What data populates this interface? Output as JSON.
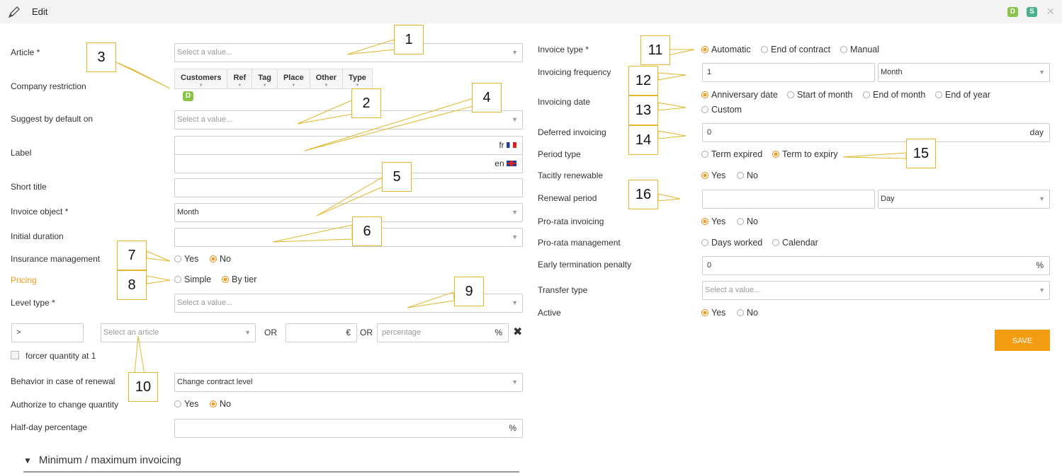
{
  "header": {
    "title": "Edit",
    "badge_d": "D",
    "badge_s": "S",
    "close": "✕",
    "icon": "pencil-icon"
  },
  "colors": {
    "accent": "#f39c12",
    "badge_d": "#8bc34a",
    "badge_s": "#4caf8f",
    "callout_border": "#e3b72c"
  },
  "left": {
    "article_label": "Article *",
    "article_placeholder": "Select a value...",
    "company_restriction_label": "Company restriction",
    "company_tabs": [
      "Customers",
      "Ref",
      "Tag",
      "Place",
      "Other",
      "Type"
    ],
    "company_badge": "D",
    "suggest_label": "Suggest by default on",
    "suggest_placeholder": "Select a value...",
    "label_label": "Label",
    "label_fr": "fr",
    "label_en": "en",
    "short_title_label": "Short title",
    "invoice_object_label": "Invoice object *",
    "invoice_object_value": "Month",
    "initial_duration_label": "Initial duration",
    "insurance_label": "Insurance management",
    "insurance_yes": "Yes",
    "insurance_no": "No",
    "pricing_label": "Pricing",
    "pricing_simple": "Simple",
    "pricing_tier": "By tier",
    "level_type_label": "Level type *",
    "level_type_placeholder": "Select a value...",
    "tier_operator": ">",
    "tier_article_placeholder": "Select an article",
    "or1": "OR",
    "tier_currency": "€",
    "or2": "OR",
    "tier_percentage_placeholder": "percentage",
    "tier_percent_sign": "%",
    "tier_delete": "✖",
    "force_qty_label": "forcer quantity at 1",
    "renewal_behavior_label": "Behavior in case of renewal",
    "renewal_behavior_value": "Change contract level",
    "authorize_label": "Authorize to change quantity",
    "authorize_yes": "Yes",
    "authorize_no": "No",
    "halfday_label": "Half-day percentage",
    "halfday_suffix": "%",
    "section_title": "Minimum / maximum invoicing",
    "section_arrow": "▼"
  },
  "right": {
    "invoice_type_label": "Invoice type *",
    "invoice_type_options": [
      "Automatic",
      "End of contract",
      "Manual"
    ],
    "freq_label": "Invoicing frequency",
    "freq_value": "1",
    "freq_unit": "Month",
    "invdate_label": "Invoicing date",
    "invdate_options": [
      "Anniversary date",
      "Start of month",
      "End of month",
      "End of year"
    ],
    "invdate_custom": "Custom",
    "deferred_label": "Deferred invoicing",
    "deferred_value": "0",
    "deferred_unit": "day",
    "period_label": "Period type",
    "period_options": [
      "Term expired",
      "Term to expiry"
    ],
    "tacit_label": "Tacitly renewable",
    "tacit_yes": "Yes",
    "tacit_no": "No",
    "renewal_period_label": "Renewal period",
    "renewal_period_unit": "Day",
    "prorata_label": "Pro-rata invoicing",
    "prorata_yes": "Yes",
    "prorata_no": "No",
    "prorata_mgmt_label": "Pro-rata management",
    "prorata_mgmt_options": [
      "Days worked",
      "Calendar"
    ],
    "early_label": "Early termination penalty",
    "early_value": "0",
    "early_suffix": "%",
    "transfer_label": "Transfer type",
    "transfer_placeholder": "Select a value...",
    "active_label": "Active",
    "active_yes": "Yes",
    "active_no": "No",
    "save_label": "SAVE"
  },
  "callouts": [
    "1",
    "2",
    "3",
    "4",
    "5",
    "6",
    "7",
    "8",
    "9",
    "10",
    "11",
    "12",
    "13",
    "14",
    "15",
    "16"
  ]
}
